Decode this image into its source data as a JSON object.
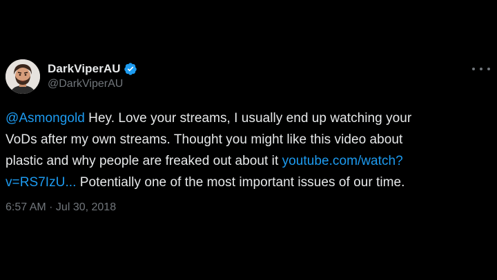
{
  "user": {
    "display_name": "DarkViperAU",
    "handle": "@DarkViperAU",
    "verified": true
  },
  "tweet": {
    "mention": "@Asmongold",
    "text_line1_rest": " Hey. Love your streams, I usually end up watching your",
    "text_line2": "VoDs after my own streams. Thought you might like this video about",
    "text_line3_pre": "plastic and why people are freaked out about it ",
    "link_part1": "youtube.com/watch?",
    "link_part2": "v=RS7IzU...",
    "text_line4_rest": " Potentially one of the most important issues of our time.",
    "timestamp": "6:57 AM · Jul 30, 2018"
  },
  "colors": {
    "background": "#000000",
    "primary_text": "#e7e9ea",
    "secondary_text": "#71767b",
    "link": "#1d9bf0",
    "verified_badge": "#1d9bf0"
  },
  "icons": {
    "verified": "verified-badge-icon",
    "more": "more-options-icon"
  }
}
